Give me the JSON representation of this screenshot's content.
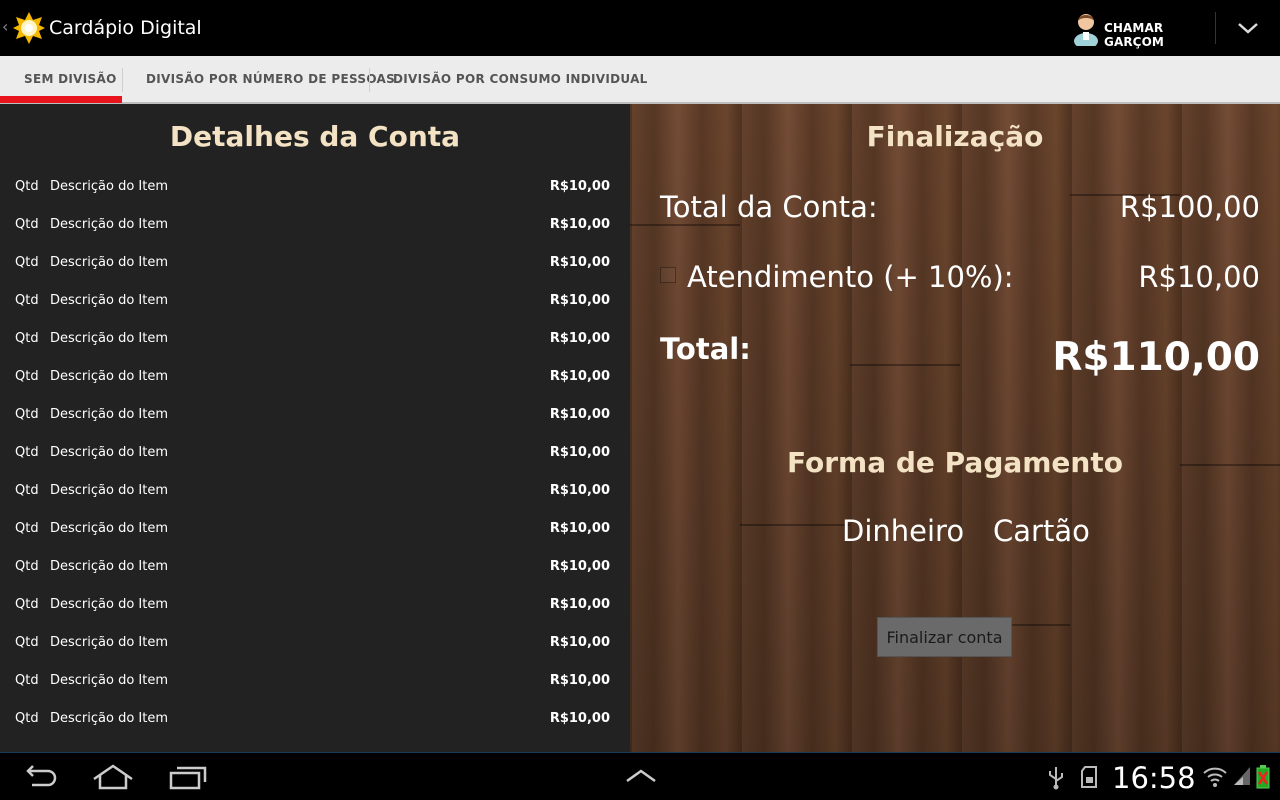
{
  "app": {
    "title": "Cardápio Digital"
  },
  "actionbar": {
    "call_waiter": "CHAMAR GARÇOM",
    "overflow_icon": "chevron-down-icon"
  },
  "tabs": [
    {
      "label": "SEM DIVISÃO",
      "selected": true
    },
    {
      "label": "DIVISÃO POR NÚMERO DE PESSOAS",
      "selected": false
    },
    {
      "label": "DIVISÃO POR CONSUMO INDIVIDUAL",
      "selected": false
    }
  ],
  "bill": {
    "title": "Detalhes da Conta",
    "items": [
      {
        "qty": "Qtd",
        "desc": "Descrição do Item",
        "price": "R$10,00"
      },
      {
        "qty": "Qtd",
        "desc": "Descrição do Item",
        "price": "R$10,00"
      },
      {
        "qty": "Qtd",
        "desc": "Descrição do Item",
        "price": "R$10,00"
      },
      {
        "qty": "Qtd",
        "desc": "Descrição do Item",
        "price": "R$10,00"
      },
      {
        "qty": "Qtd",
        "desc": "Descrição do Item",
        "price": "R$10,00"
      },
      {
        "qty": "Qtd",
        "desc": "Descrição do Item",
        "price": "R$10,00"
      },
      {
        "qty": "Qtd",
        "desc": "Descrição do Item",
        "price": "R$10,00"
      },
      {
        "qty": "Qtd",
        "desc": "Descrição do Item",
        "price": "R$10,00"
      },
      {
        "qty": "Qtd",
        "desc": "Descrição do Item",
        "price": "R$10,00"
      },
      {
        "qty": "Qtd",
        "desc": "Descrição do Item",
        "price": "R$10,00"
      },
      {
        "qty": "Qtd",
        "desc": "Descrição do Item",
        "price": "R$10,00"
      },
      {
        "qty": "Qtd",
        "desc": "Descrição do Item",
        "price": "R$10,00"
      },
      {
        "qty": "Qtd",
        "desc": "Descrição do Item",
        "price": "R$10,00"
      },
      {
        "qty": "Qtd",
        "desc": "Descrição do Item",
        "price": "R$10,00"
      },
      {
        "qty": "Qtd",
        "desc": "Descrição do Item",
        "price": "R$10,00"
      }
    ]
  },
  "finalization": {
    "title": "Finalização",
    "total_label": "Total da Conta:",
    "total_value": "R$100,00",
    "service_label": "Atendimento (+ 10%):",
    "service_value": "R$10,00",
    "service_checked": false,
    "grand_label": "Total:",
    "grand_value": "R$110,00",
    "payment_title": "Forma de Pagamento",
    "payment_options": [
      "Dinheiro",
      "Cartão"
    ],
    "finish_button": "Finalizar conta"
  },
  "system": {
    "clock": "16:58"
  },
  "colors": {
    "accent": "#e8141b",
    "heading": "#f3e3c4",
    "panel_dark": "#222222"
  }
}
